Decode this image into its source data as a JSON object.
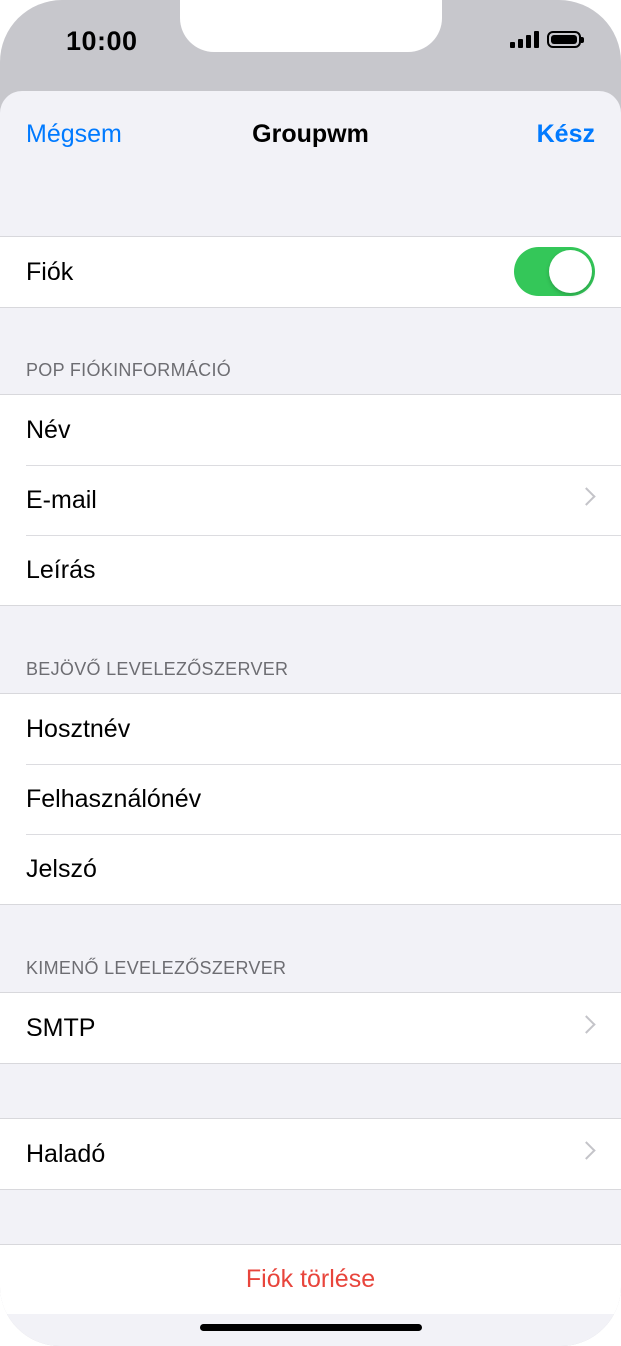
{
  "status_bar": {
    "time": "10:00"
  },
  "nav": {
    "cancel": "Mégsem",
    "title": "Groupwm",
    "done": "Kész"
  },
  "account_toggle": {
    "label": "Fiók",
    "on": true,
    "color": "#34c759"
  },
  "pop_section": {
    "header": "POP FIÓKINFORMÁCIÓ",
    "rows": [
      {
        "label": "Név"
      },
      {
        "label": "E-mail"
      },
      {
        "label": "Leírás"
      }
    ]
  },
  "incoming_section": {
    "header": "BEJÖVŐ LEVELEZŐSZERVER",
    "rows": [
      {
        "label": "Hosztnév"
      },
      {
        "label": "Felhasználónév"
      },
      {
        "label": "Jelszó"
      }
    ]
  },
  "outgoing_section": {
    "header": "KIMENŐ LEVELEZŐSZERVER",
    "rows": [
      {
        "label": "SMTP"
      }
    ]
  },
  "advanced": {
    "label": "Haladó"
  },
  "delete": {
    "label": "Fiók törlése",
    "color": "#e8453c"
  },
  "colors": {
    "accent": "#007aff",
    "background": "#f2f2f7"
  }
}
